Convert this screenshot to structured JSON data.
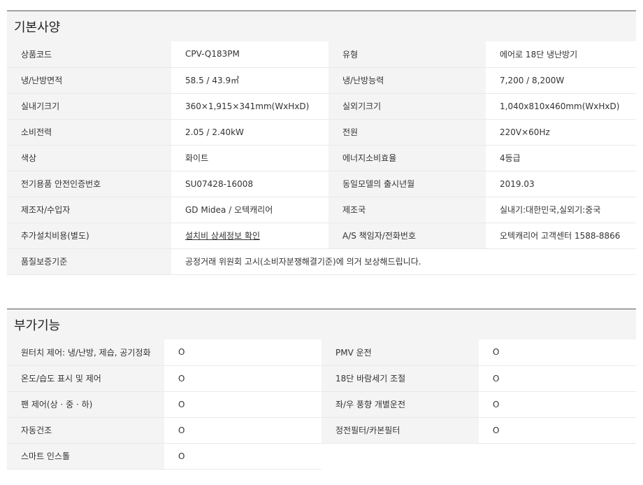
{
  "basic": {
    "title": "기본사양",
    "rows": [
      {
        "l1": "상품코드",
        "v1": "CPV-Q183PM",
        "l2": "유형",
        "v2": "에어로 18단 냉난방기"
      },
      {
        "l1": "냉/난방면적",
        "v1": "58.5 / 43.9㎡",
        "l2": "냉/난방능력",
        "v2": "7,200 / 8,200W"
      },
      {
        "l1": "실내기크기",
        "v1": "360×1,915×341mm(WxHxD)",
        "l2": "실외기크기",
        "v2": "1,040x810x460mm(WxHxD)"
      },
      {
        "l1": "소비전력",
        "v1": "2.05 / 2.40kW",
        "l2": "전원",
        "v2": "220V×60Hz"
      },
      {
        "l1": "색상",
        "v1": "화이트",
        "l2": "에너지소비효율",
        "v2": "4등급"
      },
      {
        "l1": "전기용품 안전인증번호",
        "v1": "SU07428-16008",
        "l2": "동일모델의 출시년월",
        "v2": "2019.03"
      },
      {
        "l1": "제조자/수입자",
        "v1": "GD Midea / 오텍캐리어",
        "l2": "제조국",
        "v2": "실내기:대한민국,실외기:중국"
      },
      {
        "l1": "추가설치비용(별도)",
        "v1": "설치비 상세정보 확인",
        "l2": "A/S 책임자/전화번호",
        "v2": "오텍캐리어 고객센터 1588-8866"
      }
    ],
    "warranty_label": "품질보증기준",
    "warranty_value": "공정거래 위원회 고시(소비자분쟁해결기준)에 의거 보상해드립니다."
  },
  "extra": {
    "title": "부가기능",
    "rows": [
      {
        "l1": "원터치 제어: 냉/난방, 제습, 공기정화",
        "v1": "O",
        "l2": "PMV 운전",
        "v2": "O"
      },
      {
        "l1": "온도/습도 표시 및 제어",
        "v1": "O",
        "l2": "18단 바람세기 조절",
        "v2": "O"
      },
      {
        "l1": "팬 제어(상 · 중 · 하)",
        "v1": "O",
        "l2": "좌/우 풍향 개별운전",
        "v2": "O"
      },
      {
        "l1": "자동건조",
        "v1": "O",
        "l2": "정전필터/카본필터",
        "v2": "O"
      }
    ],
    "last_label": "스마트 인스톨",
    "last_value": "O"
  }
}
